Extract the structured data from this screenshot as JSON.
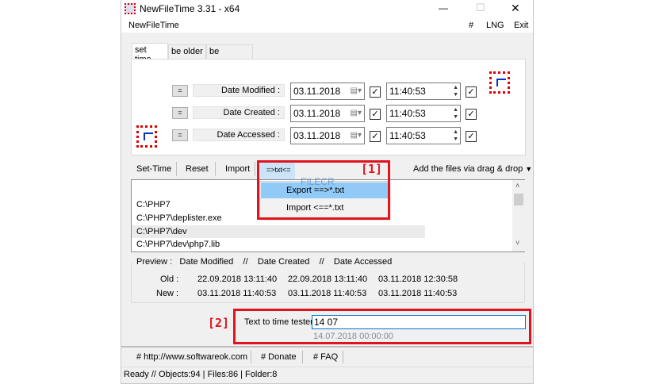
{
  "window": {
    "title": "NewFileTime 3.31 - x64",
    "controls": {
      "minimize": "—",
      "maximize": "☐",
      "close": "✕"
    }
  },
  "menu": {
    "app": "NewFileTime",
    "hash": "#",
    "lng": "LNG",
    "exit": "Exit"
  },
  "tabs": [
    {
      "label": "set time",
      "active": true
    },
    {
      "label": "be older"
    },
    {
      "label": "be younger"
    }
  ],
  "rows": [
    {
      "eq": "=",
      "label": "Date Modified :",
      "date": "03.11.2018",
      "date_checked": true,
      "time": "11:40:53",
      "time_checked": true
    },
    {
      "eq": "=",
      "label": "Date Created :",
      "date": "03.11.2018",
      "date_checked": true,
      "time": "11:40:53",
      "time_checked": true
    },
    {
      "eq": "=",
      "label": "Date Accessed :",
      "date": "03.11.2018",
      "date_checked": true,
      "time": "11:40:53",
      "time_checked": true
    }
  ],
  "toolbar": {
    "set_time": "Set-Time",
    "reset": "Reset",
    "import": "Import",
    "txt": "=>txt<=",
    "drag_drop": "Add the files via drag & drop"
  },
  "txt_menu": {
    "items": [
      "Export ==>*.txt",
      "Import <==*.txt"
    ],
    "highlighted": 0
  },
  "files": [
    "C:\\PHP7",
    "C:\\PHP7\\deplister.exe",
    "C:\\PHP7\\dev",
    "C:\\PHP7\\dev\\php7.lib"
  ],
  "selected_file": 2,
  "watermark": "FILECR",
  "preview": {
    "header": [
      "Preview  :",
      "Date Modified",
      "//",
      "Date Created",
      "//",
      "Date Accessed"
    ],
    "old_label": "Old :",
    "old": [
      "22.09.2018 13:11:40",
      "22.09.2018 13:11:40",
      "03.11.2018 12:30:58"
    ],
    "new_label": "New :",
    "new": [
      "03.11.2018 11:40:53",
      "03.11.2018 11:40:53",
      "03.11.2018 11:40:53"
    ]
  },
  "tester": {
    "label": "Text to time tester",
    "value": "14 07",
    "result": "14.07.2018 00:00:00"
  },
  "annotations": {
    "a1": "[1]",
    "a2": "[2]",
    "color": "#e0141e"
  },
  "links": [
    "# http://www.softwareok.com",
    "# Donate",
    "# FAQ"
  ],
  "status": "Ready // Objects:94 | Files:86  | Folder:8"
}
